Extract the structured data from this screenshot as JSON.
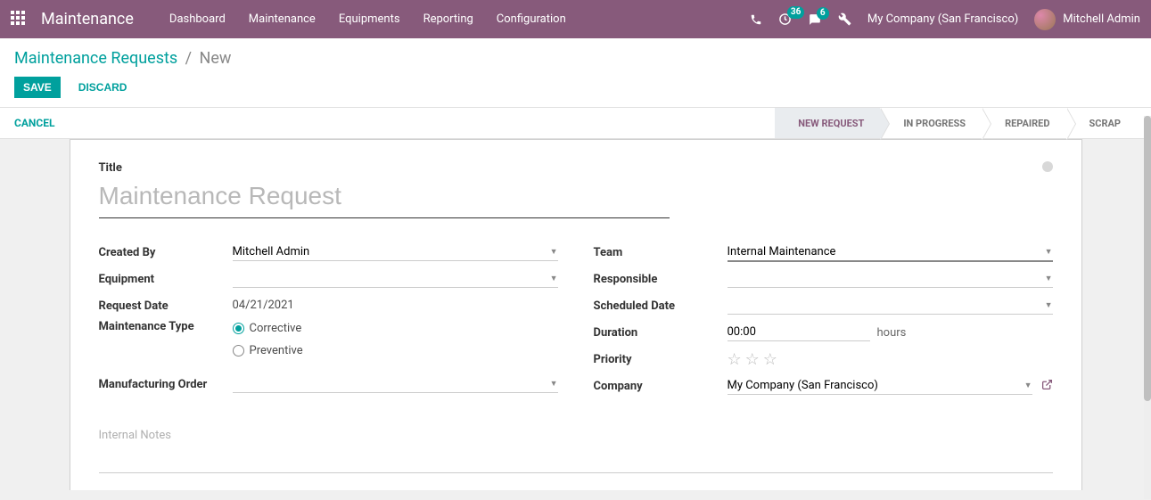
{
  "navbar": {
    "brand": "Maintenance",
    "menu": [
      "Dashboard",
      "Maintenance",
      "Equipments",
      "Reporting",
      "Configuration"
    ],
    "badge_activities": "36",
    "badge_messages": "6",
    "company": "My Company (San Francisco)",
    "user": "Mitchell Admin"
  },
  "breadcrumb": {
    "parent": "Maintenance Requests",
    "current": "New"
  },
  "buttons": {
    "save": "SAVE",
    "discard": "DISCARD",
    "cancel": "CANCEL"
  },
  "stages": [
    "NEW REQUEST",
    "IN PROGRESS",
    "REPAIRED",
    "SCRAP"
  ],
  "form": {
    "title_label": "Title",
    "title_placeholder": "Maintenance Request",
    "labels": {
      "created_by": "Created By",
      "equipment": "Equipment",
      "request_date": "Request Date",
      "maintenance_type": "Maintenance Type",
      "manufacturing_order": "Manufacturing Order",
      "team": "Team",
      "responsible": "Responsible",
      "scheduled_date": "Scheduled Date",
      "duration": "Duration",
      "priority": "Priority",
      "company": "Company"
    },
    "values": {
      "created_by": "Mitchell Admin",
      "equipment": "",
      "request_date": "04/21/2021",
      "maintenance_type_corrective": "Corrective",
      "maintenance_type_preventive": "Preventive",
      "manufacturing_order": "",
      "team": "Internal Maintenance",
      "responsible": "",
      "scheduled_date": "",
      "duration": "00:00",
      "duration_unit": "hours",
      "company": "My Company (San Francisco)"
    },
    "notes_placeholder": "Internal Notes"
  }
}
